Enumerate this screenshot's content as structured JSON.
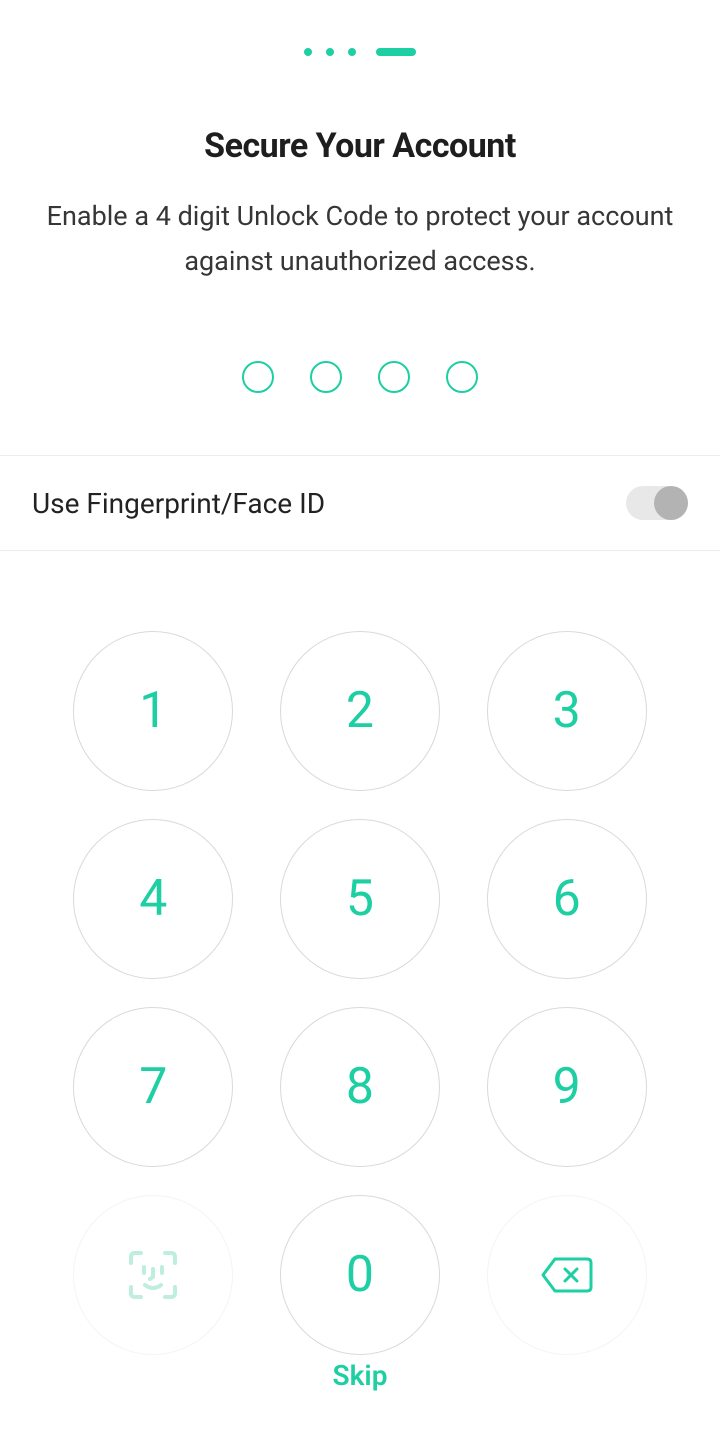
{
  "colors": {
    "accent": "#1dcfa3",
    "text": "#222222",
    "border": "#d9d9d9"
  },
  "progress": {
    "total_steps": 4,
    "current_step": 4
  },
  "header": {
    "title": "Secure Your Account",
    "subtitle": "Enable a 4 digit Unlock Code to protect your account against unauthorized access."
  },
  "pin": {
    "length": 4,
    "entered": 0
  },
  "biometric": {
    "label": "Use Fingerprint/Face ID",
    "enabled": false
  },
  "keypad": {
    "keys": [
      "1",
      "2",
      "3",
      "4",
      "5",
      "6",
      "7",
      "8",
      "9",
      "0"
    ],
    "biometric_icon": "face-id-icon",
    "backspace_icon": "backspace-icon"
  },
  "skip_label": "Skip"
}
